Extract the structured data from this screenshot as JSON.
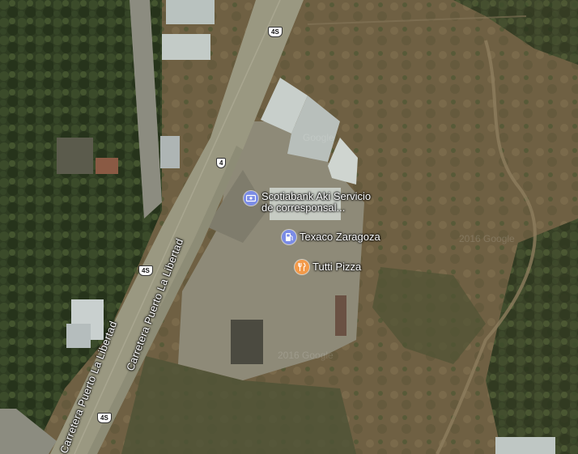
{
  "map": {
    "roads": {
      "highway_shields": [
        "4S",
        "4",
        "4S",
        "4S"
      ],
      "road_name": "Carretera Puerto La Libertad"
    },
    "pois": [
      {
        "name": "Scotiabank Aki Servicio",
        "name_line2": "de corresponsal...",
        "icon": "bank-icon",
        "color": "#7b8ce6"
      },
      {
        "name": "Texaco Zaragoza",
        "icon": "gas-station-icon",
        "color": "#7b8ce6"
      },
      {
        "name": "Tutti Pizza",
        "icon": "restaurant-icon",
        "color": "#f39a4a"
      }
    ],
    "watermarks": [
      "Google",
      "2016 Google",
      "2016 Google"
    ]
  }
}
